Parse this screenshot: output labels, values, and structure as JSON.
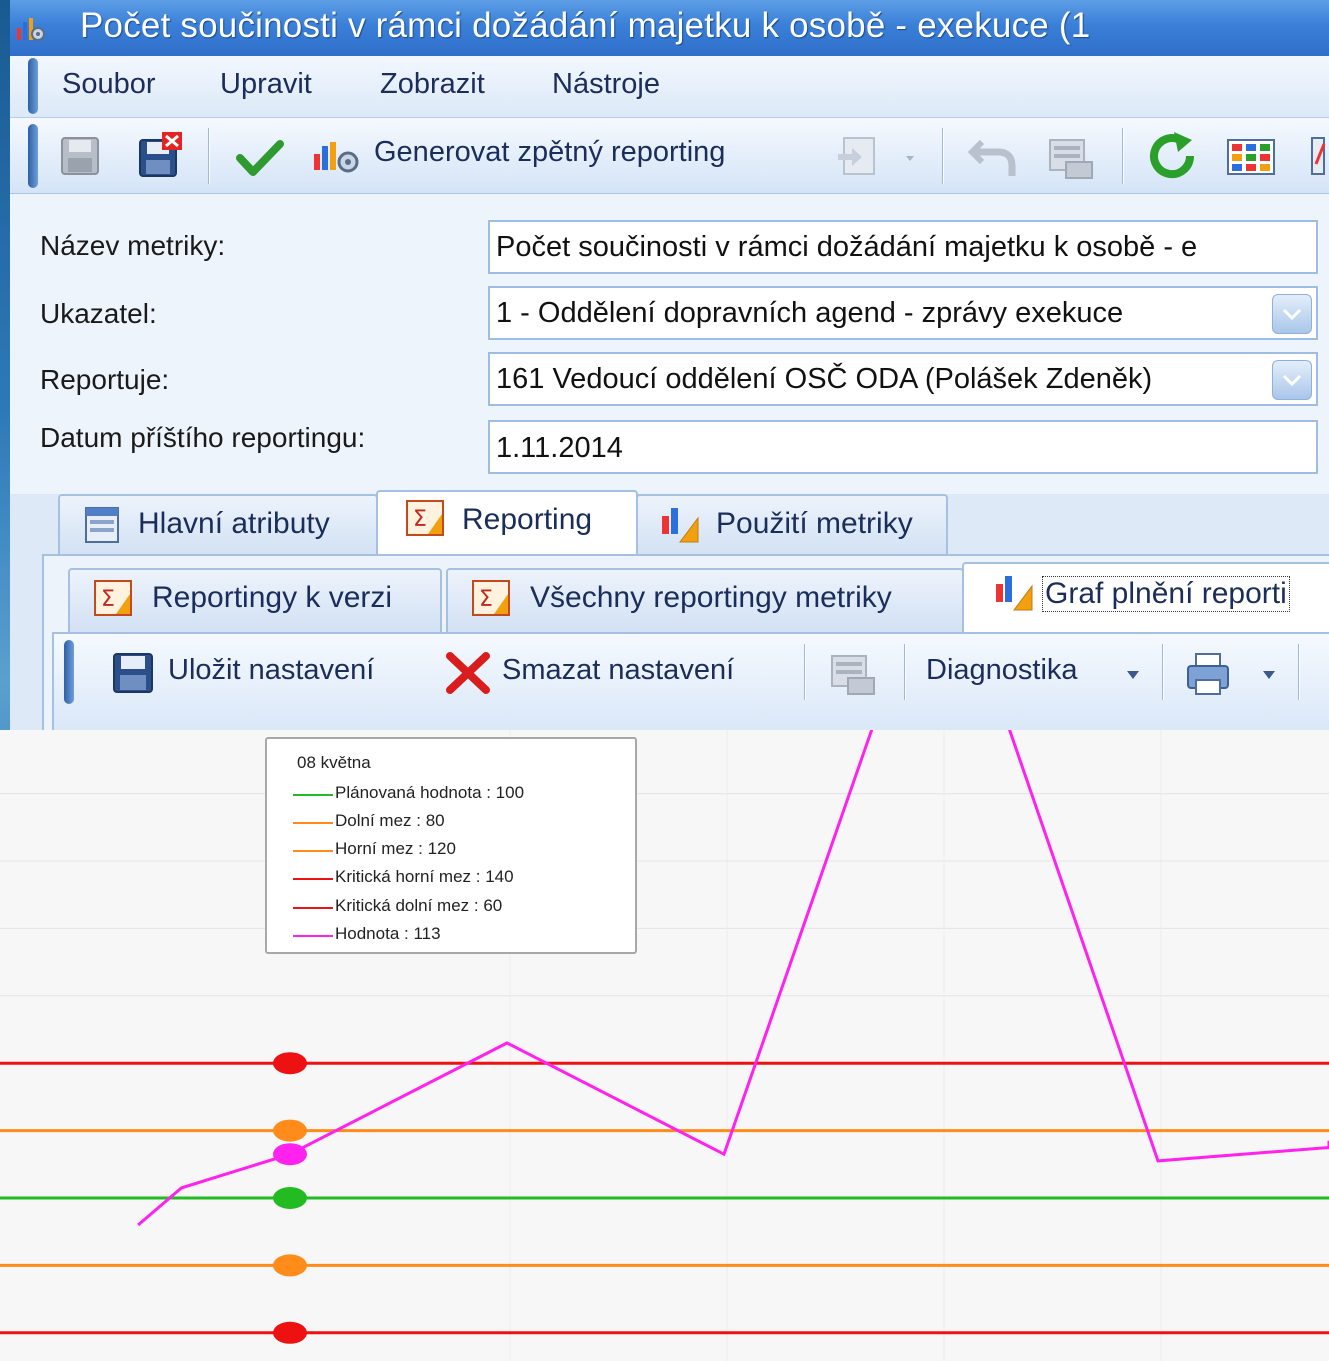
{
  "window": {
    "title": "Počet součinosti v rámci dožádání majetku k osobě - exekuce (1"
  },
  "menu": [
    "Soubor",
    "Upravit",
    "Zobrazit",
    "Nástroje"
  ],
  "toolbar": {
    "generate_label": "Generovat zpětný reporting"
  },
  "form": {
    "metric_name_label": "Název metriky:",
    "metric_name_value": "Počet součinosti v rámci dožádání majetku k osobě - e",
    "indicator_label": "Ukazatel:",
    "indicator_value": "1 - Oddělení dopravních agend - zprávy exekuce",
    "reporter_label": "Reportuje:",
    "reporter_value": "161 Vedoucí oddělení OSČ ODA (Polášek Zdeněk)",
    "next_date_label": "Datum příštího reportingu:",
    "next_date_value": "1.11.2014"
  },
  "tabs": [
    "Hlavní atributy",
    "Reporting",
    "Použití metriky"
  ],
  "subtabs": [
    "Reportingy k verzi",
    "Všechny reportingy metriky",
    "Graf plnění reporti"
  ],
  "chart_toolbar": {
    "save_label": "Uložit nastavení",
    "delete_label": "Smazat nastavení",
    "diagnostics_label": "Diagnostika"
  },
  "chart_data": {
    "type": "line",
    "tooltip": {
      "title": "08 května",
      "entries": [
        {
          "text": "Plánovaná hodnota : 100",
          "color": "#22bb22"
        },
        {
          "text": "Dolní mez : 80",
          "color": "#ff8c1a"
        },
        {
          "text": "Horní mez : 120",
          "color": "#ff8c1a"
        },
        {
          "text": "Kritická horní mez : 140",
          "color": "#ee1111"
        },
        {
          "text": "Kritická dolní mez : 60",
          "color": "#ee1111"
        },
        {
          "text": "Hodnota : 113",
          "color": "#ff22ee"
        }
      ]
    },
    "ylim": [
      58,
      300
    ],
    "xlim": [
      -0.7,
      5.5
    ],
    "series": [
      {
        "key": "critical_upper",
        "values": [
          140,
          140,
          140,
          140,
          140,
          140,
          140
        ],
        "color": "#ee1111"
      },
      {
        "key": "upper",
        "values": [
          120,
          120,
          120,
          120,
          120,
          120,
          120
        ],
        "color": "#ff8c1a"
      },
      {
        "key": "planned",
        "values": [
          100,
          100,
          100,
          100,
          100,
          100,
          100
        ],
        "color": "#22bb22"
      },
      {
        "key": "lower",
        "values": [
          80,
          80,
          80,
          80,
          80,
          80,
          80
        ],
        "color": "#ff8c1a"
      },
      {
        "key": "critical_lower",
        "values": [
          60,
          60,
          60,
          60,
          60,
          60,
          60
        ],
        "color": "#ee1111"
      }
    ],
    "value_series": {
      "color": "#ff22ee",
      "x": [
        -0.7,
        -0.5,
        0,
        1,
        2,
        3,
        4,
        5,
        5.5
      ],
      "y": [
        92,
        103,
        113,
        146,
        113,
        298,
        111,
        115,
        117
      ]
    },
    "marker_x": 0,
    "grid": true
  }
}
